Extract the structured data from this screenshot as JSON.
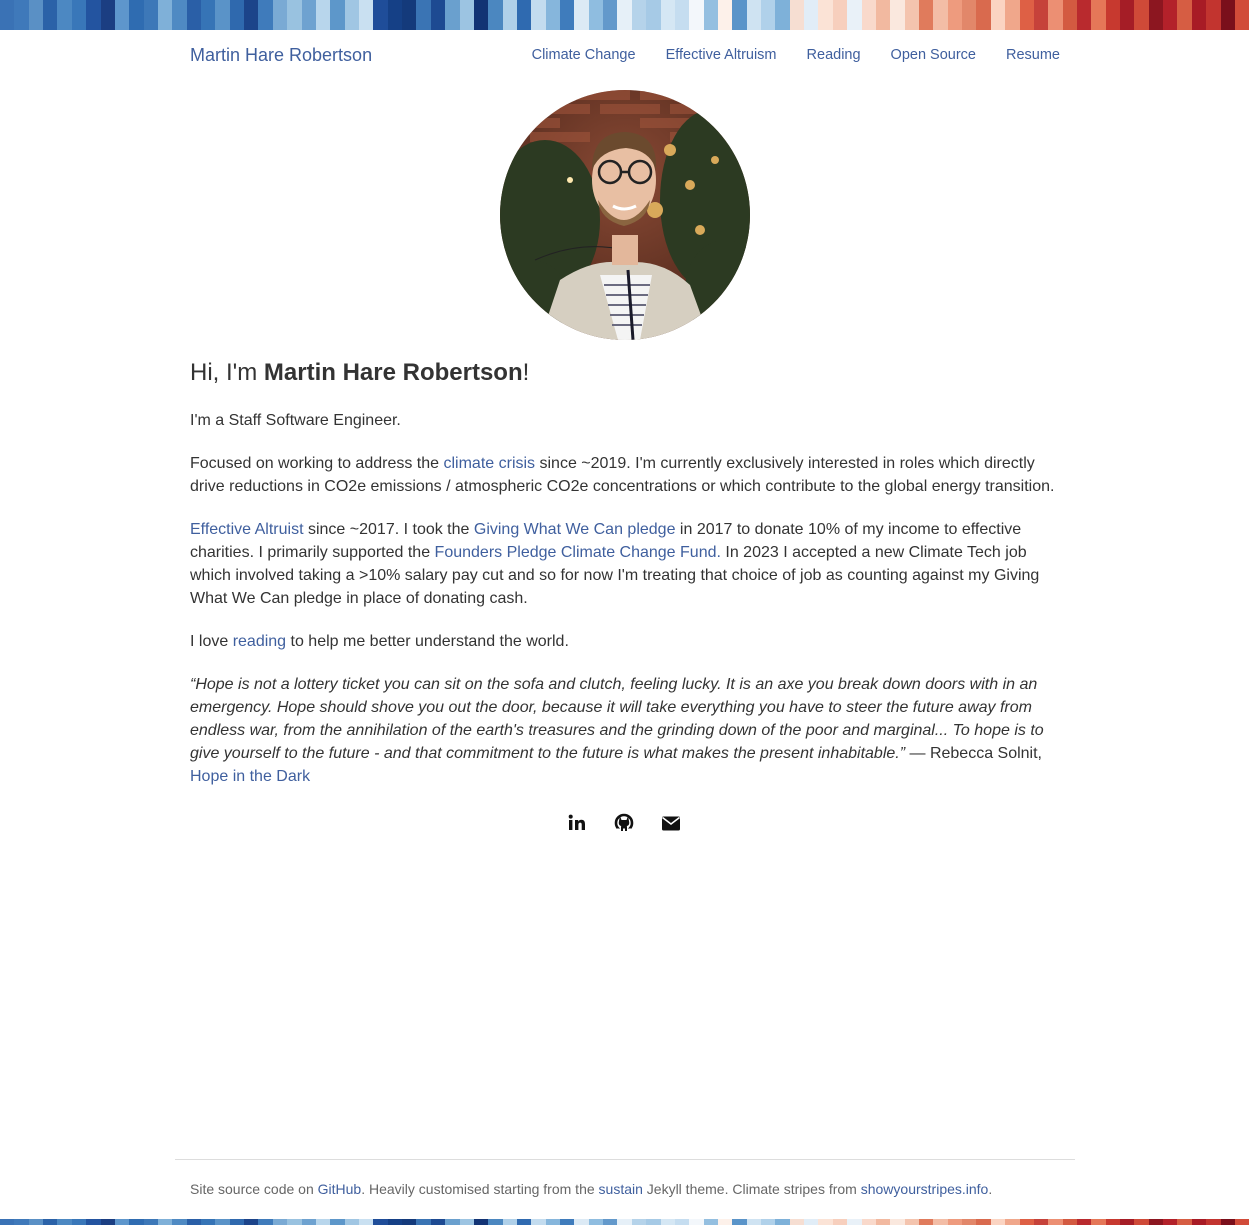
{
  "colors": {
    "link": "#3f5f9e",
    "text": "#333333",
    "footer_text": "#666666",
    "stripes": [
      "#3a72b5",
      "#3f79ba",
      "#5a90c5",
      "#2b62a8",
      "#4c88c2",
      "#3977b9",
      "#2354a0",
      "#1b3e82",
      "#5e96cc",
      "#2f6cb1",
      "#3d78b8",
      "#7fb0d8",
      "#4f8ac3",
      "#2a5fa7",
      "#3674b6",
      "#5a93c8",
      "#2f69ae",
      "#1c448a",
      "#3f7bbb",
      "#7aaad4",
      "#99c2e0",
      "#6ea2d0",
      "#b8d6ec",
      "#5d97ca",
      "#a0c6e3",
      "#c9e0f1",
      "#1f4d99",
      "#154086",
      "#143a7b",
      "#3a74b4",
      "#1d4a92",
      "#6aa0ce",
      "#9cc4e2",
      "#123374",
      "#4b87c0",
      "#afd0e9",
      "#2f6ab0",
      "#c3dcef",
      "#86b6dc",
      "#3f7cbc",
      "#dceaf5",
      "#8fbde0",
      "#6399cb",
      "#e6f0f8",
      "#b5d3ea",
      "#a6cae6",
      "#d5e7f4",
      "#c5ddf0",
      "#f3f7fb",
      "#94bfe0",
      "#fdf1ea",
      "#5a94c9",
      "#cfe3f2",
      "#b0d1ea",
      "#7eb1d9",
      "#f6ded2",
      "#e1edf7",
      "#fbe3d6",
      "#f7cfbd",
      "#e9f1f8",
      "#f9d9cb",
      "#f2b9a0",
      "#fae8de",
      "#f4c4ae",
      "#e07b5c",
      "#f3bda6",
      "#ee9b7e",
      "#e2876a",
      "#d96a4e",
      "#fbd4c2",
      "#f0a78b",
      "#de6045",
      "#c6423a",
      "#ec8f73",
      "#d35a41",
      "#b92a2e",
      "#e57758",
      "#c7392f",
      "#a51d26",
      "#cf4a38",
      "#8c1620",
      "#b3212a",
      "#d65d43",
      "#a81b25",
      "#c2342f",
      "#7a0f1b",
      "#d14b39"
    ]
  },
  "header": {
    "site_title": "Martin Hare Robertson",
    "nav": [
      "Climate Change",
      "Effective Altruism",
      "Reading",
      "Open Source",
      "Resume"
    ]
  },
  "intro": {
    "greeting": "Hi, I'm ",
    "name": "Martin Hare Robertson",
    "exclaim": "!"
  },
  "para1": "I'm a Staff Software Engineer.",
  "para2": {
    "t1": "Focused on working to address the ",
    "link": "climate crisis",
    "t2": " since ~2019. I'm currently exclusively interested in roles which directly drive reductions in CO2e emissions / atmospheric CO2e concentrations or which contribute to the global energy transition."
  },
  "para3": {
    "link1": "Effective Altruist",
    "t1": " since ~2017. I took the ",
    "link2": "Giving What We Can pledge",
    "t2": " in 2017 to donate 10% of my income to effective charities. I primarily supported the ",
    "link3": "Founders Pledge Climate Change Fund.",
    "t3": " In 2023 I accepted a new Climate Tech job which involved taking a >10% salary pay cut and so for now I'm treating that choice of job as counting against my Giving What We Can pledge in place of donating cash."
  },
  "para4": {
    "t1": "I love ",
    "link": "reading",
    "t2": " to help me better understand the world."
  },
  "quote": {
    "text": "“Hope is not a lottery ticket you can sit on the sofa and clutch, feeling lucky. It is an axe you break down doors with in an emergency. Hope should shove you out the door, because it will take everything you have to steer the future away from endless war, from the annihilation of the earth's treasures and the grinding down of the poor and marginal... To hope is to give yourself to the future - and that commitment to the future is what makes the present inhabitable.”",
    "attribution": " — Rebecca Solnit, ",
    "book": "Hope in the Dark"
  },
  "socials": {
    "linkedin": "linkedin-icon",
    "github": "github-icon",
    "email": "envelope-icon"
  },
  "footer": {
    "t1": "Site source code on ",
    "link1": "GitHub",
    "t2": ". Heavily customised starting from the ",
    "link2": "sustain",
    "t3": " Jekyll theme. Climate stripes from ",
    "link3": "showyourstripes.info",
    "t4": "."
  }
}
